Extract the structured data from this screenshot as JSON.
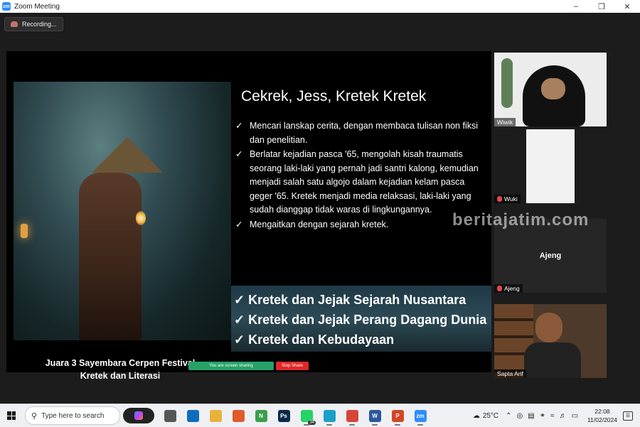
{
  "window": {
    "app_logo": "zm",
    "title": "Zoom Meeting",
    "controls": [
      "–",
      "❐",
      "✕"
    ]
  },
  "recording": {
    "label": "Recording..."
  },
  "slide": {
    "title": "Cekrek, Jess, Kretek Kretek",
    "bullets": [
      "Mencari lanskap cerita, dengan membaca tulisan non fiksi dan penelitian.",
      "Berlatar kejadian pasca '65, mengolah kisah traumatis seorang laki-laki yang pernah jadi santri kalong, kemudian menjadi salah satu algojo dalam kejadian kelam pasca geger '65. Kretek menjadi media relaksasi, laki-laki yang sudah dianggap tidak waras di lingkungannya.",
      "Mengaitkan dengan sejarah kretek."
    ],
    "check": "✓",
    "lower_items": [
      "Kretek dan Jejak Sejarah Nusantara",
      "Kretek dan Jejak Perang Dagang Dunia",
      "Kretek dan Kebudayaan"
    ],
    "caption_line1": "Juara 3 Sayembara Cerpen Festival",
    "caption_line2": "Kretek dan Literasi"
  },
  "sharing": {
    "status": "You are screen sharing",
    "stop_label": "Stop Share"
  },
  "watermark": "beritajatim.com",
  "participants": [
    {
      "name": "Wiwik",
      "muted": false
    },
    {
      "name": "Wuki",
      "muted": true
    },
    {
      "name": "Ajeng",
      "muted": true,
      "center_label": "Ajeng"
    },
    {
      "name": "Sapta Arif",
      "muted": false
    }
  ],
  "taskbar": {
    "search_placeholder": "Type here to search",
    "apps": [
      {
        "icon": "task-view-icon",
        "label": "",
        "color": "#555555",
        "running": false
      },
      {
        "icon": "mail-icon",
        "label": "",
        "color": "#0f6cbd",
        "running": false
      },
      {
        "icon": "file-explorer-icon",
        "label": "",
        "color": "#e8b33a",
        "running": false
      },
      {
        "icon": "ms-store-icon",
        "label": "",
        "color": "#e05a2a",
        "running": false
      },
      {
        "icon": "excel-like-icon",
        "label": "N",
        "color": "#3aa04a",
        "running": false
      },
      {
        "icon": "photoshop-icon",
        "label": "Ps",
        "color": "#0a2a4a",
        "running": false
      },
      {
        "icon": "whatsapp-icon",
        "label": "",
        "color": "#25d366",
        "running": true,
        "badge": "34"
      },
      {
        "icon": "edge-icon",
        "label": "",
        "color": "#1ca0c8",
        "running": true
      },
      {
        "icon": "chrome-icon",
        "label": "",
        "color": "#d44638",
        "running": true
      },
      {
        "icon": "word-icon",
        "label": "W",
        "color": "#2b579a",
        "running": true
      },
      {
        "icon": "powerpoint-icon",
        "label": "P",
        "color": "#d24726",
        "running": true
      },
      {
        "icon": "zoom-icon",
        "label": "zm",
        "color": "#2d8cff",
        "running": true
      }
    ],
    "weather": "25°C",
    "time": "22:08",
    "date": "11/02/2024"
  }
}
